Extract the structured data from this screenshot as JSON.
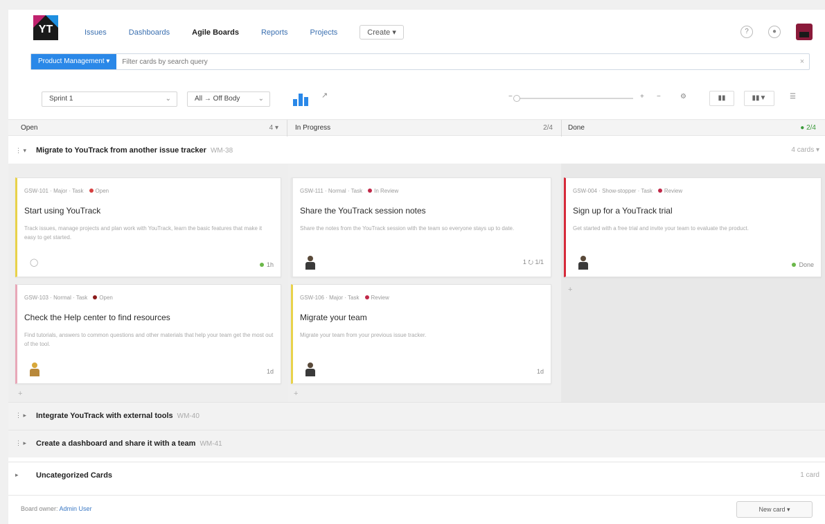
{
  "nav": {
    "items": [
      "Issues",
      "Dashboards",
      "Agile Boards",
      "Reports",
      "Projects"
    ],
    "active_index": 2,
    "more_label": "Create ▾"
  },
  "search": {
    "board_label": "Product Management ▾",
    "placeholder": "Filter cards by search query"
  },
  "toolbar": {
    "sprint_label": "Sprint 1",
    "group_label": "All → Off Body"
  },
  "columns": [
    {
      "name": "Open",
      "count": "4 ▾"
    },
    {
      "name": "In Progress",
      "count": "2/4"
    },
    {
      "name": "Done",
      "count": "● 2/4"
    }
  ],
  "swimlanes": [
    {
      "title": "Migrate to YouTrack from another issue tracker",
      "meta": "WM-38",
      "right": "4 cards ▾"
    },
    {
      "title": "Integrate YouTrack with external tools",
      "meta": "WM-40"
    },
    {
      "title": "Create a dashboard and share it with a team",
      "meta": "WM-41"
    },
    {
      "title": "Uncategorized Cards",
      "right": "1 card"
    }
  ],
  "cards": [
    {
      "meta": "GSW-101 · Major · Task",
      "state": "Open",
      "state_color": "#d64040",
      "title": "Start using YouTrack",
      "desc": "Track issues, manage projects and plan work with YouTrack, learn the basic features that make it easy to get started.",
      "foot": "1h",
      "border": "#e8d24a",
      "person": "none"
    },
    {
      "meta": "GSW-103 · Normal · Task",
      "state": "Open",
      "state_color": "#8b1a1a",
      "title": "Check the Help center to find resources",
      "desc": "Find tutorials, answers to common questions and other materials that help your team get the most out of the tool.",
      "foot": "1d",
      "border": "#e8a8b8",
      "person": "yellow"
    },
    {
      "meta": "GSW-111 · Normal · Task",
      "state": "In Review",
      "state_color": "#c02848",
      "title": "Share the YouTrack session notes",
      "desc": "Share the notes from the YouTrack session with the team so everyone stays up to date.",
      "foot": "1 ⭮ 1/1",
      "border": "#e8e8e8",
      "person": "dark"
    },
    {
      "meta": "GSW-106 · Major · Task",
      "state": "Review",
      "state_color": "#c02848",
      "title": "Migrate your team",
      "desc": "Migrate your team from your previous issue tracker.",
      "foot": "1d",
      "border": "#e8d24a",
      "person": "dark"
    },
    {
      "meta": "GSW-004 · Show-stopper · Task",
      "state": "Review",
      "state_color": "#c02848",
      "title": "Sign up for a YouTrack trial",
      "desc": "Get started with a free trial and invite your team to evaluate the product.",
      "foot": "Done",
      "border": "#d62a3a",
      "person": "dark"
    }
  ],
  "footer": {
    "text": "Board owner: ",
    "link": "Admin User",
    "button": "New card ▾"
  }
}
